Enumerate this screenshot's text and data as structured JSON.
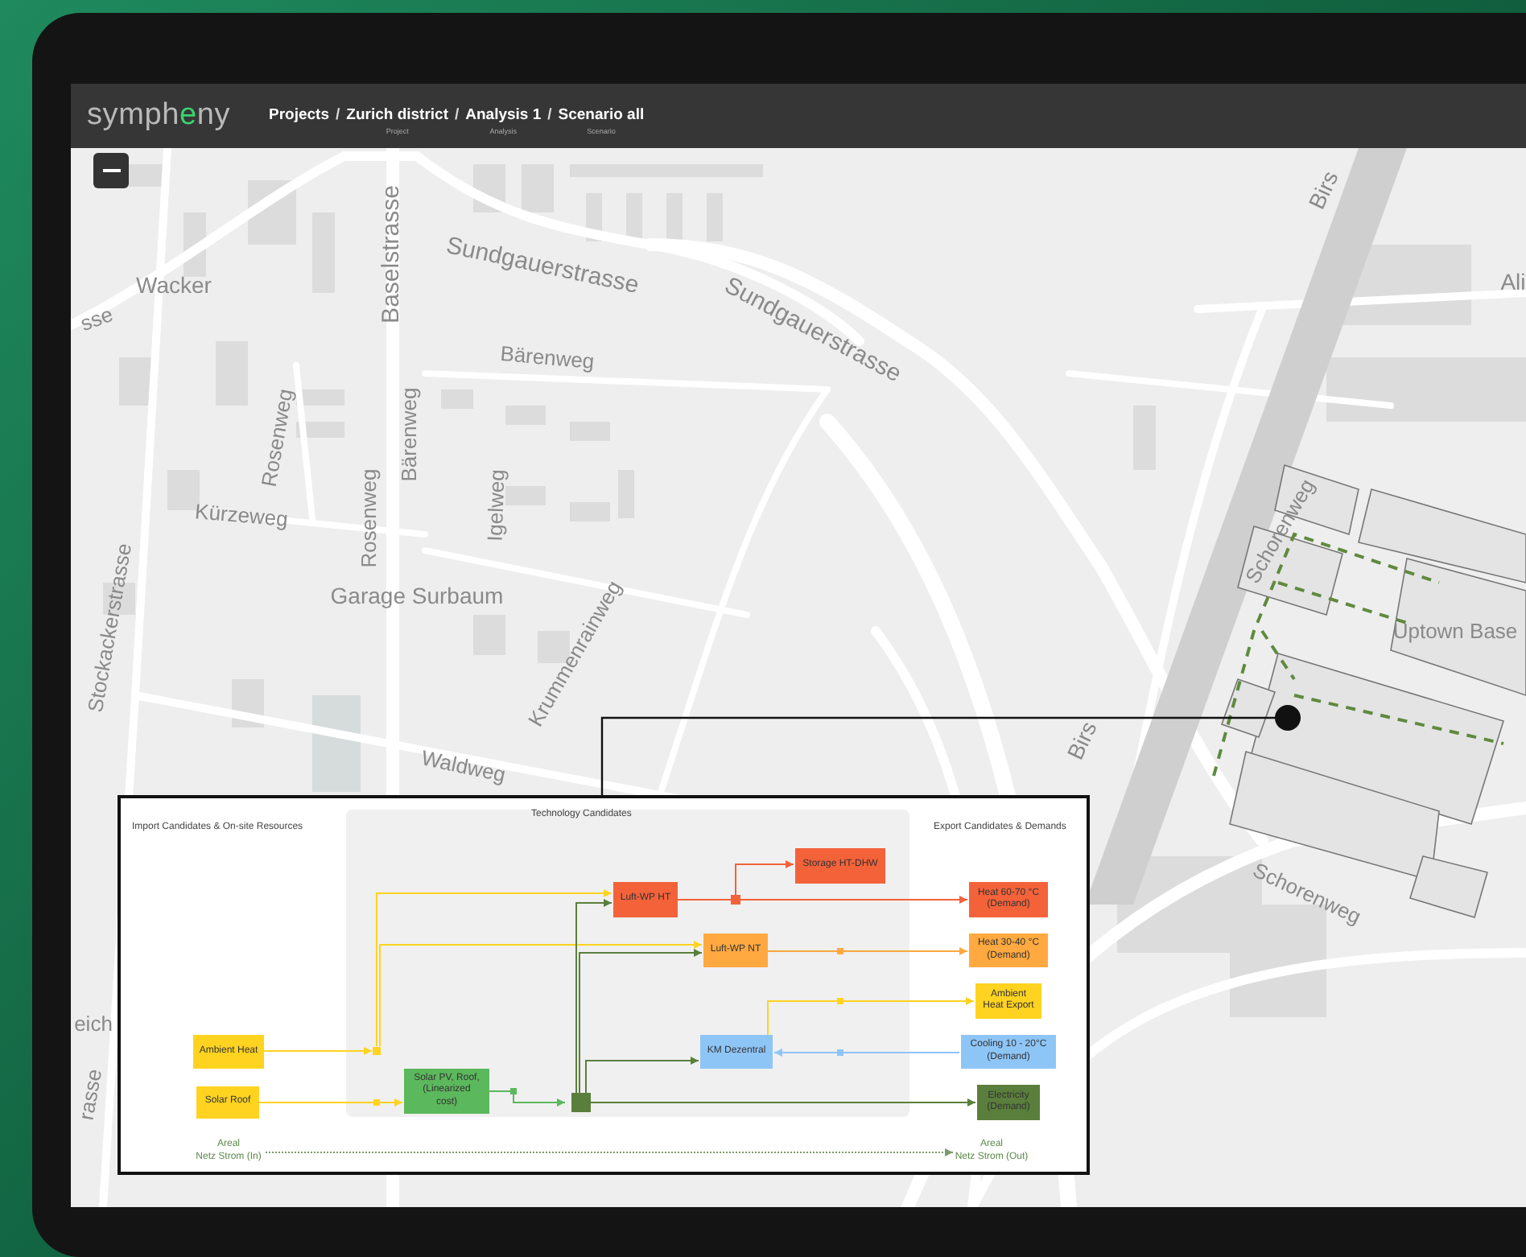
{
  "header": {
    "logo": {
      "parts": [
        {
          "text": "symph",
          "accent": false
        },
        {
          "text": "e",
          "accent": true
        },
        {
          "text": "ny",
          "accent": false
        }
      ]
    },
    "breadcrumbs": [
      {
        "label": "Projects"
      },
      {
        "separator_before": "/",
        "label": "Zurich district",
        "sublabel": "Project"
      },
      {
        "separator_before": "/",
        "label": "Analysis 1",
        "sublabel": "Analysis"
      },
      {
        "separator_before": "/",
        "label": "Scenario all",
        "sublabel": "Scenario"
      }
    ]
  },
  "map": {
    "labels": [
      {
        "text": "Wacker"
      },
      {
        "text": "sse"
      },
      {
        "text": "Baselstrasse"
      },
      {
        "text": "Sundgauerstrasse"
      },
      {
        "text": "Sundgauerstrasse"
      },
      {
        "text": "Bärenweg"
      },
      {
        "text": "Rosenweg"
      },
      {
        "text": "Bärenweg"
      },
      {
        "text": "Rosenweg"
      },
      {
        "text": "Igelweg"
      },
      {
        "text": "Kürzeweg"
      },
      {
        "text": "Garage Surbaum"
      },
      {
        "text": "Stockackerstrasse"
      },
      {
        "text": "Krummenrainweg"
      },
      {
        "text": "Waldweg"
      },
      {
        "text": "Birs"
      },
      {
        "text": "Birs"
      },
      {
        "text": "Ali"
      },
      {
        "text": "Schorenweg"
      },
      {
        "text": "Schorenweg"
      },
      {
        "text": "Uptown Base"
      },
      {
        "text": "eich"
      },
      {
        "text": "rasse"
      }
    ]
  },
  "diagram": {
    "sections": [
      {
        "title": "Import Candidates & On-site Resources"
      },
      {
        "title": "Technology Candidates"
      },
      {
        "title": "Export Candidates & Demands"
      }
    ],
    "nodes": [
      {
        "lines": [
          "Ambient Heat"
        ],
        "color": "#ffd320"
      },
      {
        "lines": [
          "Solar Roof"
        ],
        "color": "#ffd320"
      },
      {
        "lines": [
          "Solar PV, Roof,",
          "(Linearized",
          "cost)"
        ],
        "color": "#5cb85c"
      },
      {
        "lines": [
          "Luft-WP HT"
        ],
        "color": "#f4623a"
      },
      {
        "lines": [
          "Storage HT-DHW"
        ],
        "color": "#f4623a"
      },
      {
        "lines": [
          "Heat 60-70 °C",
          "(Demand)"
        ],
        "color": "#f4623a"
      },
      {
        "lines": [
          "Luft-WP NT"
        ],
        "color": "#ffa940"
      },
      {
        "lines": [
          "Heat 30-40 °C",
          "(Demand)"
        ],
        "color": "#ffa940"
      },
      {
        "lines": [
          "Ambient",
          "Heat Export"
        ],
        "color": "#ffd320"
      },
      {
        "lines": [
          "KM Dezentral"
        ],
        "color": "#8ec5f7"
      },
      {
        "lines": [
          "Cooling 10 - 20°C",
          "(Demand)"
        ],
        "color": "#8ec5f7"
      },
      {
        "lines": [
          "Electricity",
          "(Demand)"
        ],
        "color": "#5a7f3c"
      }
    ],
    "grid": [
      {
        "lines": [
          "Areal",
          "Netz Strom (In)"
        ]
      },
      {
        "lines": [
          "Areal",
          "Netz Strom (Out)"
        ]
      }
    ]
  }
}
